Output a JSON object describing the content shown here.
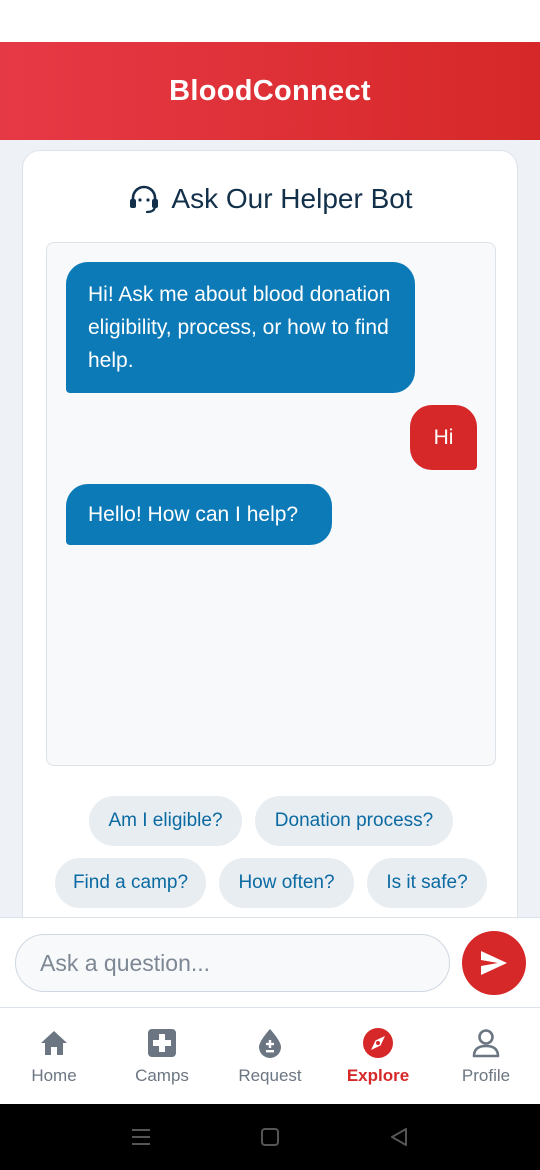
{
  "app": {
    "title": "BloodConnect"
  },
  "helper": {
    "title": "Ask Our Helper Bot",
    "icon": "headset-icon",
    "messages": [
      {
        "sender": "bot",
        "text": "Hi! Ask me about blood donation eligibility, process, or how to find help."
      },
      {
        "sender": "user",
        "text": "Hi"
      },
      {
        "sender": "bot",
        "text": "Hello! How can I help?"
      }
    ],
    "quick_replies": [
      "Am I eligible?",
      "Donation process?",
      "Find a camp?",
      "How often?",
      "Is it safe?"
    ]
  },
  "input": {
    "placeholder": "Ask a question...",
    "value": "",
    "send_icon": "send-icon"
  },
  "nav": {
    "items": [
      {
        "label": "Home",
        "icon": "home-icon",
        "active": false
      },
      {
        "label": "Camps",
        "icon": "medical-cross-icon",
        "active": false
      },
      {
        "label": "Request",
        "icon": "blood-drop-icon",
        "active": false
      },
      {
        "label": "Explore",
        "icon": "compass-icon",
        "active": true
      },
      {
        "label": "Profile",
        "icon": "person-icon",
        "active": false
      }
    ]
  },
  "colors": {
    "brand_red": "#d62828",
    "bot_bubble": "#0d7ab8",
    "chip_text": "#0a6aa1",
    "title_text": "#12304a"
  }
}
